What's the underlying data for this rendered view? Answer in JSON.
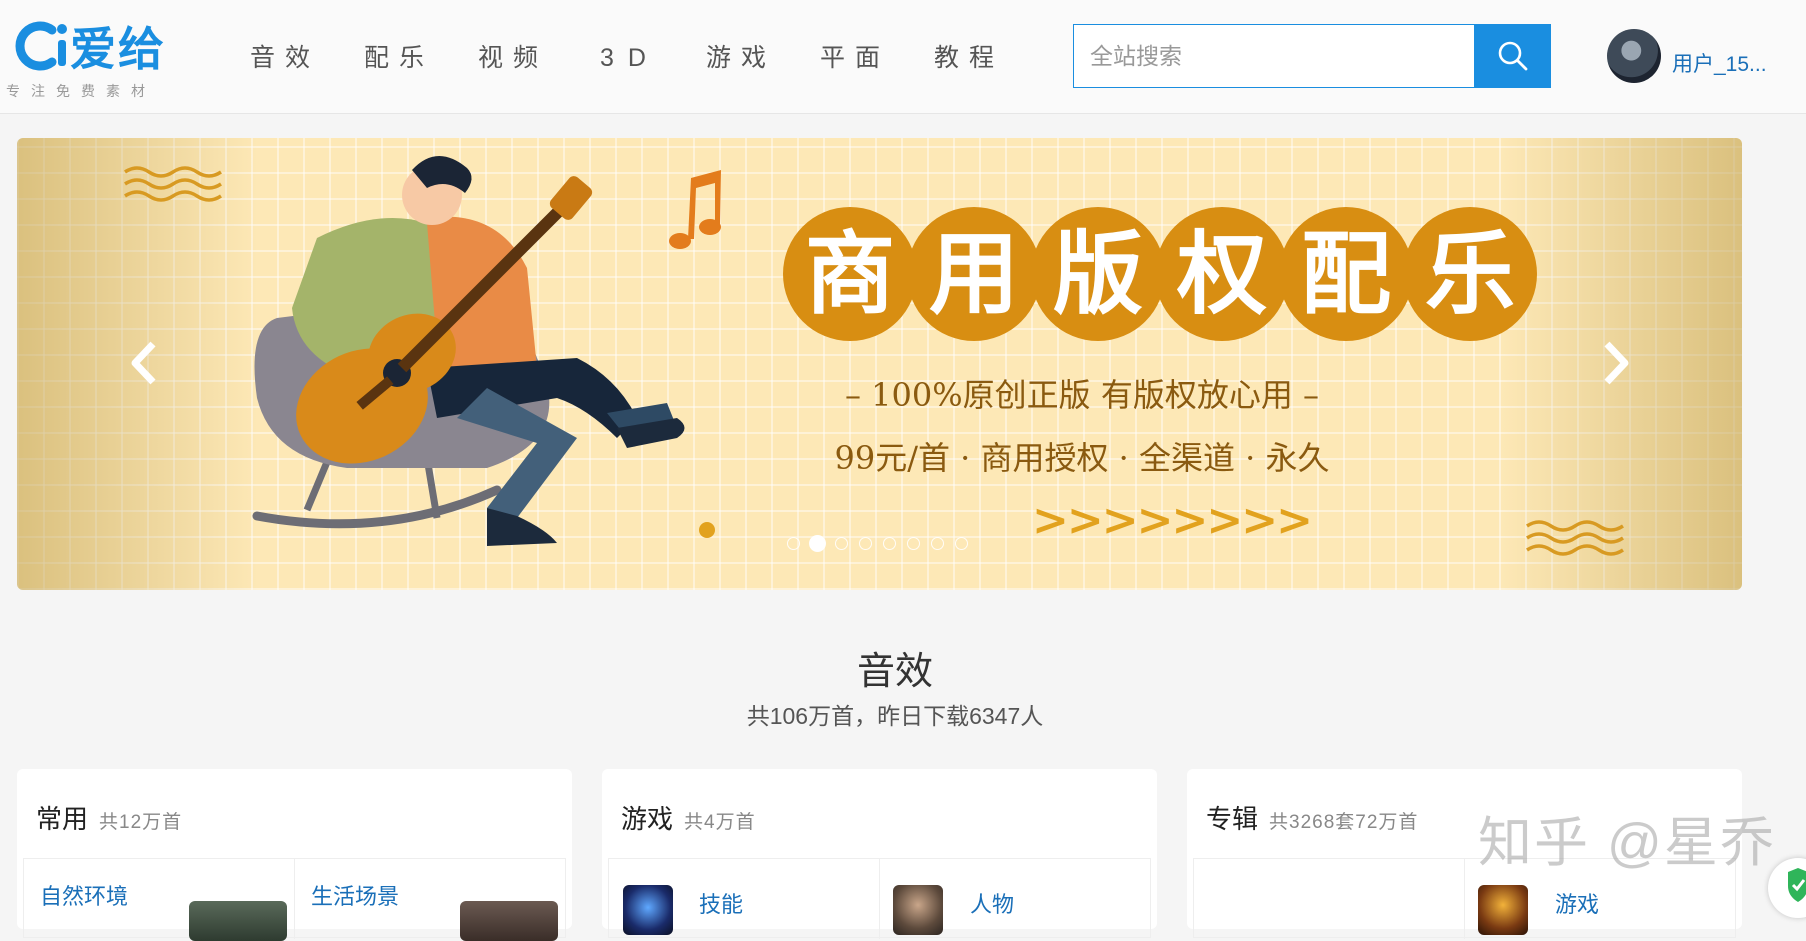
{
  "header": {
    "logo_text": "爱给",
    "slogan": "专注免费素材",
    "nav": [
      "音效",
      "配乐",
      "视频",
      "3D",
      "游戏",
      "平面",
      "教程"
    ],
    "search": {
      "placeholder": "全站搜索"
    },
    "user": {
      "name": "用户_15..."
    }
  },
  "banner": {
    "title_chars": [
      "商",
      "用",
      "版",
      "权",
      "配",
      "乐"
    ],
    "subtitle": "– 100%原创正版 有版权放心用 –",
    "detail": "99元/首 · 商用授权 · 全渠道 · 永久",
    "arrows": ">>>>>>>>",
    "slide_count": 8,
    "active_slide": 2,
    "colors": {
      "circle": "#d88e12",
      "background": "#fde8b6",
      "text": "#8a5a10"
    }
  },
  "section": {
    "title": "音效",
    "subtitle": "共106万首，昨日下载6347人"
  },
  "cards": [
    {
      "title": "常用",
      "count": "共12万首",
      "items": [
        {
          "label": "自然环境"
        },
        {
          "label": "生活场景"
        }
      ]
    },
    {
      "title": "游戏",
      "count": "共4万首",
      "items": [
        {
          "label": "技能"
        },
        {
          "label": "人物"
        }
      ]
    },
    {
      "title": "专辑",
      "count": "共3268套72万首",
      "items": [
        {
          "label": ""
        },
        {
          "label": "游戏"
        }
      ]
    }
  ],
  "watermark": "知乎 @星乔",
  "accent_color": "#1a8ee0",
  "icons": [
    "logo-ci-icon",
    "search-icon",
    "chevron-left-icon",
    "chevron-right-icon",
    "shield-check-icon"
  ]
}
